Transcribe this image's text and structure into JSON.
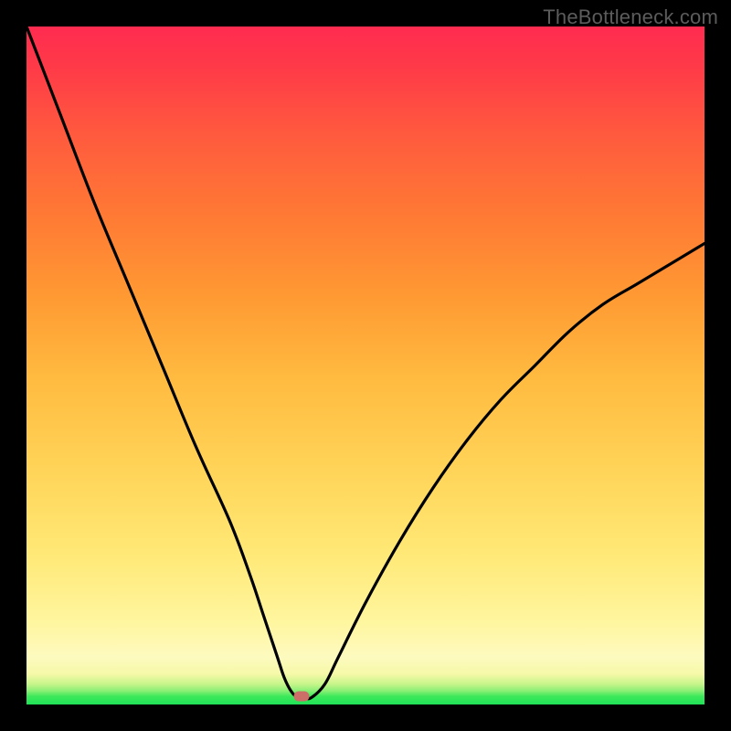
{
  "watermark": "TheBottleneck.com",
  "chart_data": {
    "type": "line",
    "title": "",
    "xlabel": "",
    "ylabel": "",
    "xlim": [
      0,
      100
    ],
    "ylim": [
      0,
      100
    ],
    "grid": false,
    "legend": false,
    "series": [
      {
        "name": "bottleneck-curve",
        "x": [
          0,
          5,
          10,
          15,
          20,
          25,
          30,
          33,
          35,
          37,
          38,
          39,
          40,
          41,
          42,
          44,
          46,
          50,
          55,
          60,
          65,
          70,
          75,
          80,
          85,
          90,
          95,
          100
        ],
        "y": [
          100,
          87,
          74,
          62,
          50,
          38,
          27,
          19,
          13,
          7,
          4,
          2,
          1,
          1,
          1,
          3,
          7,
          15,
          24,
          32,
          39,
          45,
          50,
          55,
          59,
          62,
          65,
          68
        ]
      }
    ],
    "marker": {
      "x": 40.5,
      "y": 1.2
    },
    "gradient_stops": [
      {
        "pos": 0,
        "color": "#1fe257"
      },
      {
        "pos": 4.5,
        "color": "#f6f9a8"
      },
      {
        "pos": 22,
        "color": "#ffe977"
      },
      {
        "pos": 48,
        "color": "#ffbb40"
      },
      {
        "pos": 84,
        "color": "#ff5a3e"
      },
      {
        "pos": 100,
        "color": "#ff2b50"
      }
    ]
  }
}
